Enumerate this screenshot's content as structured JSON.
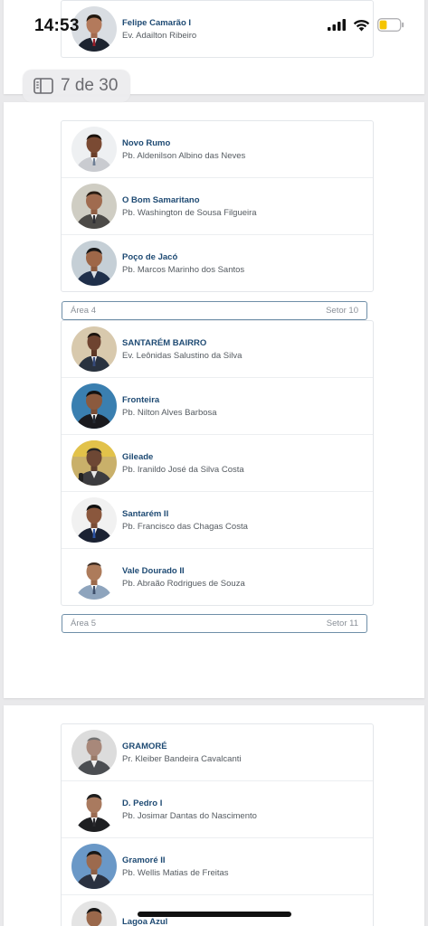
{
  "status_bar": {
    "time": "14:53"
  },
  "viewer": {
    "page_counter": "7 de 30"
  },
  "page1": {
    "rows": [
      {
        "church": "Felipe Camarão I",
        "pastor": "Ev. Adailton Ribeiro"
      }
    ]
  },
  "page2": {
    "group1": [
      {
        "church": "Novo Rumo",
        "pastor": "Pb. Aldenilson Albino das Neves"
      },
      {
        "church": "O Bom Samaritano",
        "pastor": "Pb. Washington de Sousa Filgueira"
      },
      {
        "church": "Poço de Jacó",
        "pastor": "Pb. Marcos Marinho dos Santos"
      }
    ],
    "area4": {
      "area": "Área 4",
      "setor": "Setor 10"
    },
    "group2": [
      {
        "church": "SANTARÉM BAIRRO",
        "pastor": "Ev. Leônidas Salustino da Silva"
      },
      {
        "church": "Fronteira",
        "pastor": "Pb. Nilton Alves Barbosa"
      },
      {
        "church": "Gileade",
        "pastor": "Pb. Iranildo José da Silva Costa"
      },
      {
        "church": "Santarém II",
        "pastor": "Pb. Francisco das Chagas Costa"
      },
      {
        "church": "Vale Dourado II",
        "pastor": "Pb. Abraão Rodrigues de Souza"
      }
    ],
    "area5": {
      "area": "Área 5",
      "setor": "Setor 11"
    }
  },
  "page3": {
    "group1": [
      {
        "church": "GRAMORÉ",
        "pastor": "Pr. Kleiber Bandeira Cavalcanti"
      },
      {
        "church": "D. Pedro I",
        "pastor": "Pb. Josimar Dantas do Nascimento"
      },
      {
        "church": "Gramoré II",
        "pastor": "Pb. Wellis Matias de Freitas"
      },
      {
        "church": "Lagoa Azul",
        "pastor": ""
      }
    ]
  },
  "colors": {
    "church_name": "#1e4a73",
    "area_border": "#6f8fa8",
    "battery": "#f5c400"
  }
}
